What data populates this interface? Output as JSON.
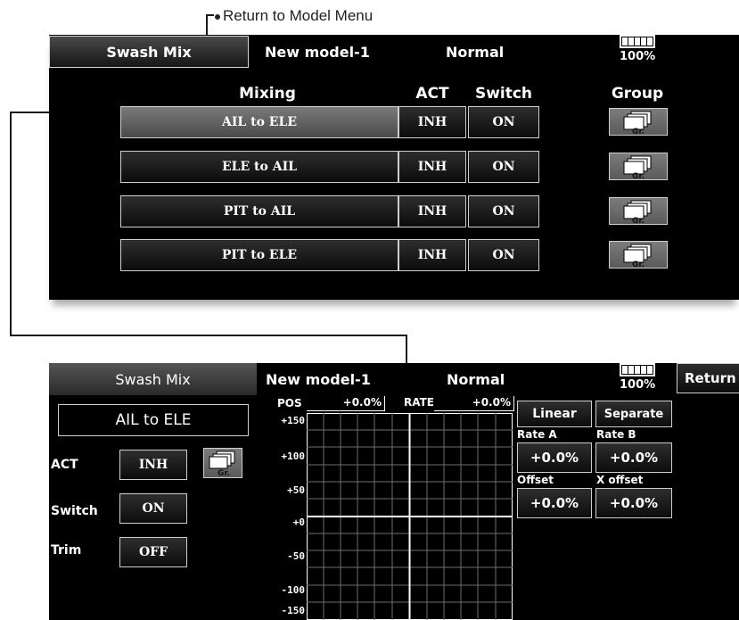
{
  "annotation": {
    "return_to_menu": "Return to Model Menu"
  },
  "list_screen": {
    "tab": "Swash Mix",
    "model": "New model-1",
    "condition": "Normal",
    "battery": "100%",
    "headers": {
      "mixing": "Mixing",
      "act": "ACT",
      "switch": "Switch",
      "group": "Group"
    },
    "rows": [
      {
        "name": "AIL to ELE",
        "act": "INH",
        "switch": "ON",
        "group": "Gr."
      },
      {
        "name": "ELE to AIL",
        "act": "INH",
        "switch": "ON",
        "group": "Gr."
      },
      {
        "name": "PIT to AIL",
        "act": "INH",
        "switch": "ON",
        "group": "Gr."
      },
      {
        "name": "PIT to ELE",
        "act": "INH",
        "switch": "ON",
        "group": "Gr."
      }
    ]
  },
  "detail_screen": {
    "tab": "Swash Mix",
    "model": "New model-1",
    "condition": "Normal",
    "battery": "100%",
    "return": "Return",
    "mix_name": "AIL to ELE",
    "act_label": "ACT",
    "act_value": "INH",
    "group": "Gr.",
    "switch_label": "Switch",
    "switch_value": "ON",
    "trim_label": "Trim",
    "trim_value": "OFF",
    "pos_label": "POS",
    "pos_value": "+0.0%",
    "rate_label": "RATE",
    "rate_value": "+0.0%",
    "y_axis": [
      "+150",
      "+100",
      "+50",
      "+0",
      "-50",
      "-100",
      "-150"
    ],
    "linear": "Linear",
    "separate": "Separate",
    "rate_a_label": "Rate A",
    "rate_b_label": "Rate B",
    "rate_a": "+0.0%",
    "rate_b": "+0.0%",
    "offset_label": "Offset",
    "x_offset_label": "X offset",
    "offset": "+0.0%",
    "x_offset": "+0.0%"
  }
}
